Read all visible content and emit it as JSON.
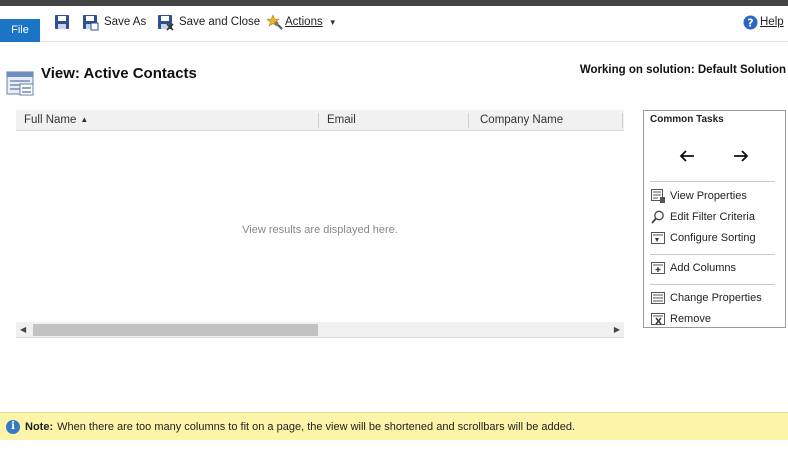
{
  "toolbar": {
    "file_label": "File",
    "save_as_label": "Save As",
    "save_close_label": "Save and Close",
    "actions_label": "Actions",
    "help_label": "Help"
  },
  "page": {
    "title": "View: Active Contacts",
    "solution": "Working on solution: Default Solution"
  },
  "grid": {
    "columns": [
      {
        "label": "Full Name",
        "sort": "ascending"
      },
      {
        "label": "Email"
      },
      {
        "label": "Company Name"
      }
    ],
    "empty_message": "View results are displayed here."
  },
  "tasks": {
    "title": "Common Tasks",
    "items": [
      {
        "label": "View Properties",
        "icon": "view-properties-icon"
      },
      {
        "label": "Edit Filter Criteria",
        "icon": "filter-icon"
      },
      {
        "label": "Configure Sorting",
        "icon": "sorting-icon"
      },
      {
        "label": "Add Columns",
        "icon": "add-columns-icon"
      },
      {
        "label": "Change Properties",
        "icon": "change-properties-icon"
      },
      {
        "label": "Remove",
        "icon": "remove-icon"
      }
    ]
  },
  "note": {
    "label": "Note:",
    "text": "When there are too many columns to fit on a page, the view will be shortened and scrollbars will be added."
  },
  "colors": {
    "file_button": "#1b74c5",
    "note_background": "#fcf5a9",
    "info_icon": "#3579c7",
    "header_background": "#f1f1f1"
  }
}
